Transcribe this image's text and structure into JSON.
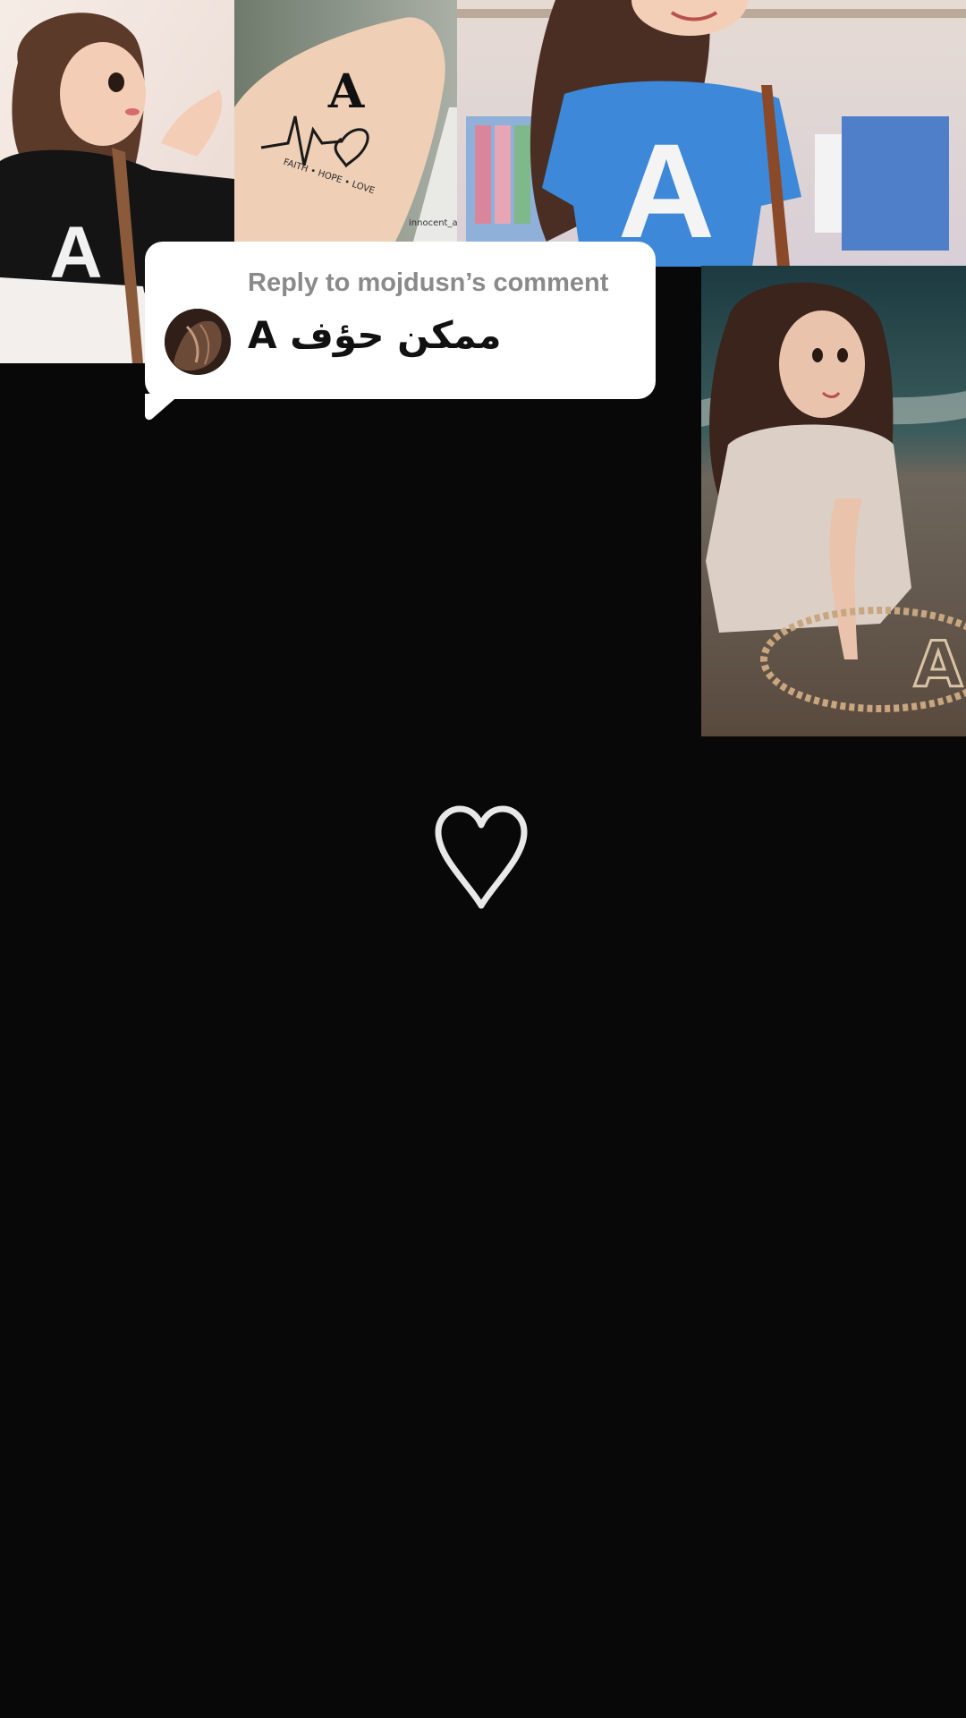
{
  "reply_bubble": {
    "reply_label": "Reply to mojdusn’s comment",
    "comment_text": "A ممكن حؤف",
    "avatar_icon": "commenter-avatar"
  },
  "photos": {
    "hoodie_letter": "A",
    "tattoo_letter": "A",
    "tattoo_caption": "FAITH • HOPE • LOVE",
    "tattoo_watermark": "innocent_aa",
    "shirt_letter": "A",
    "sand_letter": "A"
  },
  "heart": {
    "icon": "heart-outline-icon",
    "color": "#e8e8e8"
  },
  "colors": {
    "background": "#080808",
    "bubble": "#ffffff",
    "reply_label": "#8a8a8a",
    "comment_text": "#111111"
  }
}
